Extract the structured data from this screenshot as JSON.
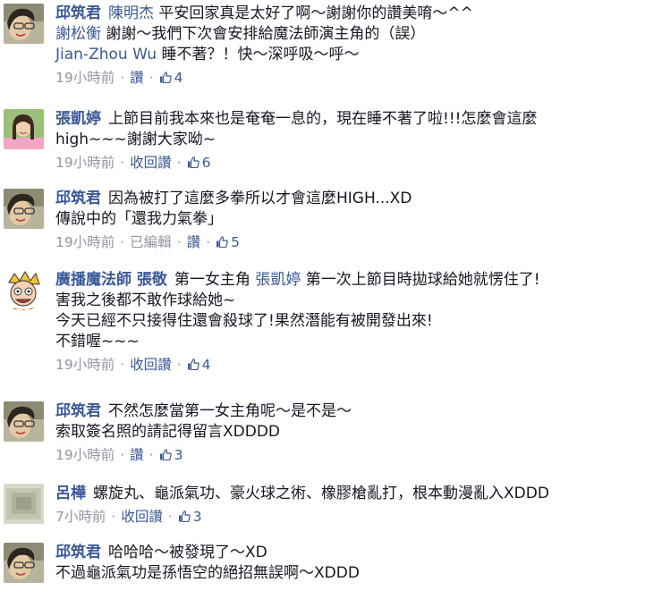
{
  "comments": [
    {
      "author": "邱筑君",
      "lines": [
        [
          {
            "t": "陳明杰",
            "m": true
          },
          {
            "t": " 平安回家真是太好了啊～謝謝你的讚美唷～^^"
          }
        ],
        [
          {
            "t": "謝松衡",
            "m": true
          },
          {
            "t": " 謝謝～我們下次會安排給魔法師演主角的（誤）"
          }
        ],
        [
          {
            "t": "Jian-Zhou Wu",
            "m": true
          },
          {
            "t": " 睡不著？！快～深呼吸～呼～"
          }
        ]
      ],
      "meta": {
        "time": "19小時前",
        "actions": [
          "讚"
        ],
        "likes": "4"
      }
    },
    {
      "author": "張凱婷",
      "lines": [
        [
          {
            "t": "上節目前我本來也是奄奄一息的，現在睡不著了啦!!!怎麼會這麼"
          }
        ],
        [
          {
            "t": "high~~~謝謝大家呦~"
          }
        ]
      ],
      "meta": {
        "time": "19小時前",
        "actions": [
          "收回讚"
        ],
        "likes": "6"
      }
    },
    {
      "author": "邱筑君",
      "lines": [
        [
          {
            "t": "因為被打了這麼多拳所以才會這麼HIGH...XD"
          }
        ],
        [
          {
            "t": "傳說中的「還我力氣拳」"
          }
        ]
      ],
      "meta": {
        "time": "19小時前",
        "plain": "已編輯",
        "actions": [
          "讚"
        ],
        "likes": "5"
      }
    },
    {
      "author": "廣播魔法師 張敬",
      "lines": [
        [
          {
            "t": "第一女主角 "
          },
          {
            "t": "張凱婷",
            "m": true
          },
          {
            "t": " 第一次上節目時拋球給她就愣住了!"
          }
        ],
        [
          {
            "t": "害我之後都不敢作球給她~"
          }
        ],
        [
          {
            "t": "今天已經不只接得住還會殺球了!果然潛能有被開發出來!"
          }
        ],
        [
          {
            "t": "不錯喔~~~"
          }
        ]
      ],
      "meta": {
        "time": "19小時前",
        "actions": [
          "收回讚"
        ],
        "likes": "4"
      }
    },
    {
      "author": "邱筑君",
      "lines": [
        [
          {
            "t": "不然怎麼當第一女主角呢～是不是～"
          }
        ],
        [
          {
            "t": "索取簽名照的請記得留言XDDDD"
          }
        ]
      ],
      "meta": {
        "time": "19小時前",
        "actions": [
          "讚"
        ],
        "likes": "3"
      }
    },
    {
      "author": "呂樺",
      "lines": [
        [
          {
            "t": "螺旋丸、龜派氣功、豪火球之術、橡膠槍亂打，根本動漫亂入XDDD"
          }
        ]
      ],
      "meta": {
        "time": "7小時前",
        "actions": [
          "收回讚"
        ],
        "likes": "3"
      }
    },
    {
      "author": "邱筑君",
      "lines": [
        [
          {
            "t": "哈哈哈～被發現了～XD"
          }
        ],
        [
          {
            "t": "不過龜派氣功是孫悟空的絕招無誤啊～XDDD"
          }
        ]
      ],
      "meta": null
    }
  ],
  "colors": {
    "link": "#3b5998",
    "meta": "#9197a3",
    "text": "#141823"
  }
}
